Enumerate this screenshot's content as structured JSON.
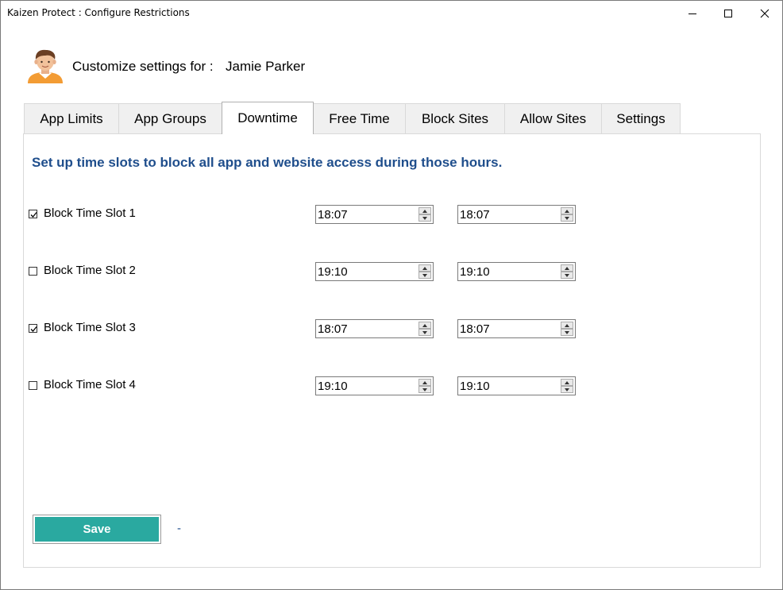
{
  "window": {
    "title": "Kaizen Protect : Configure Restrictions",
    "controls": [
      "minimize-icon",
      "maximize-icon",
      "close-icon"
    ]
  },
  "header": {
    "customize_label": "Customize settings for :",
    "user_name": "Jamie Parker",
    "avatar_icon": "user-avatar-icon"
  },
  "tabs": [
    {
      "label": "App Limits",
      "active": false
    },
    {
      "label": "App Groups",
      "active": false
    },
    {
      "label": "Downtime",
      "active": true
    },
    {
      "label": "Free Time",
      "active": false
    },
    {
      "label": "Block Sites",
      "active": false
    },
    {
      "label": "Allow Sites",
      "active": false
    },
    {
      "label": "Settings",
      "active": false
    }
  ],
  "downtime": {
    "intro": "Set up time slots to block all app and website access during those hours.",
    "slots": [
      {
        "label": "Block Time Slot 1",
        "checked": true,
        "start": "18:07",
        "end": "18:07"
      },
      {
        "label": "Block Time Slot 2",
        "checked": false,
        "start": "19:10",
        "end": "19:10"
      },
      {
        "label": "Block Time Slot 3",
        "checked": true,
        "start": "18:07",
        "end": "18:07"
      },
      {
        "label": "Block Time Slot 4",
        "checked": false,
        "start": "19:10",
        "end": "19:10"
      }
    ]
  },
  "footer": {
    "save_label": "Save",
    "status_text": "-"
  },
  "colors": {
    "accent_button": "#2aa9a0",
    "intro_text": "#1f4e8c",
    "tab_bg": "#f0f0f0"
  }
}
